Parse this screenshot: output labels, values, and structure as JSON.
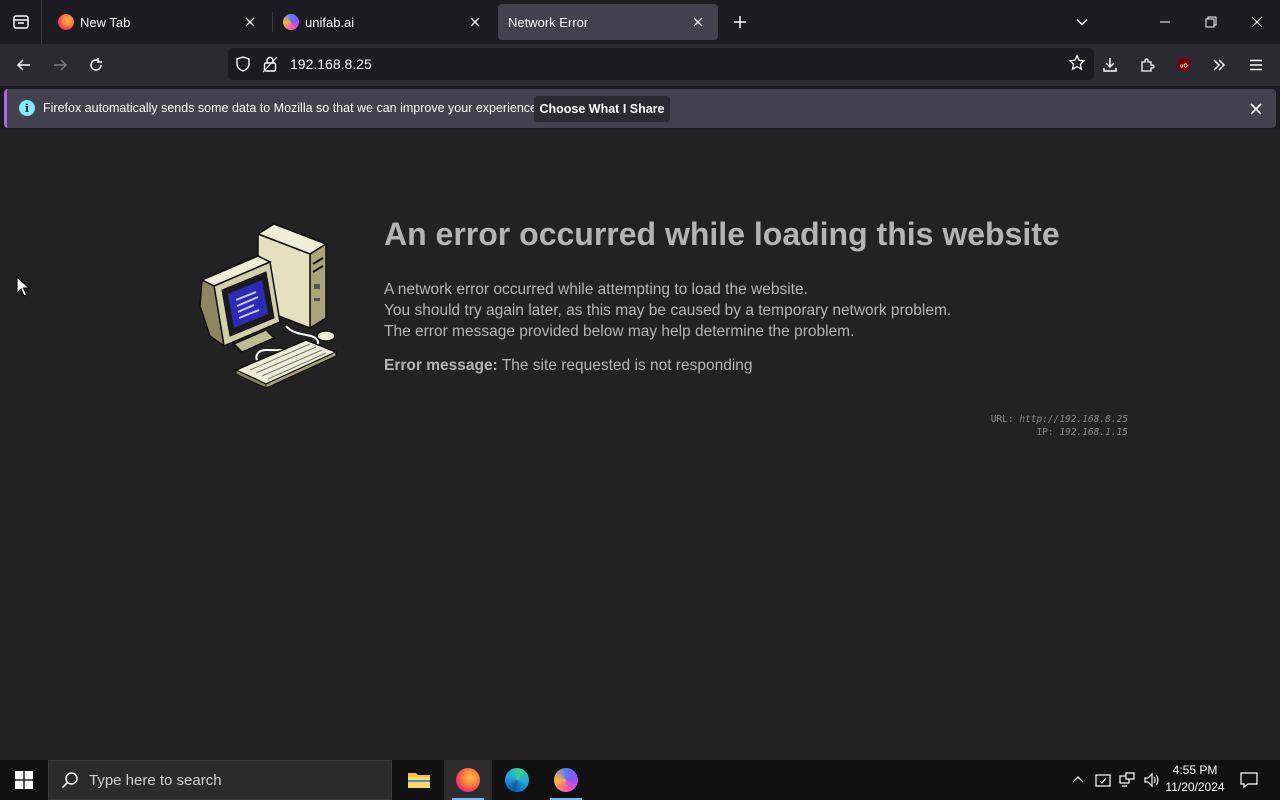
{
  "browser": {
    "tabs": [
      {
        "title": "New Tab",
        "active": false
      },
      {
        "title": "unifab.ai",
        "active": false
      },
      {
        "title": "Network Error",
        "active": true
      }
    ],
    "url": "192.168.8.25"
  },
  "notification": {
    "message": "Firefox automatically sends some data to Mozilla so that we can improve your experience.",
    "button": "Choose What I Share"
  },
  "page": {
    "title": "An error occurred while loading this website",
    "body_lines": [
      "A network error occurred while attempting to load the website.",
      "You should try again later, as this may be caused by a temporary network problem.",
      "The error message provided below may help determine the problem."
    ],
    "error_label": "Error message:",
    "error_value": "The site requested is not responding",
    "diag_url_label": "URL:",
    "diag_url": "http://192.168.8.25",
    "diag_ip_label": "IP:",
    "diag_ip": "192.168.1.15"
  },
  "taskbar": {
    "search_placeholder": "Type here to search",
    "time": "4:55 PM",
    "date": "11/20/2024"
  },
  "colors": {
    "accent_notification": "#b364e0",
    "error_text": "#b4b4b4"
  }
}
